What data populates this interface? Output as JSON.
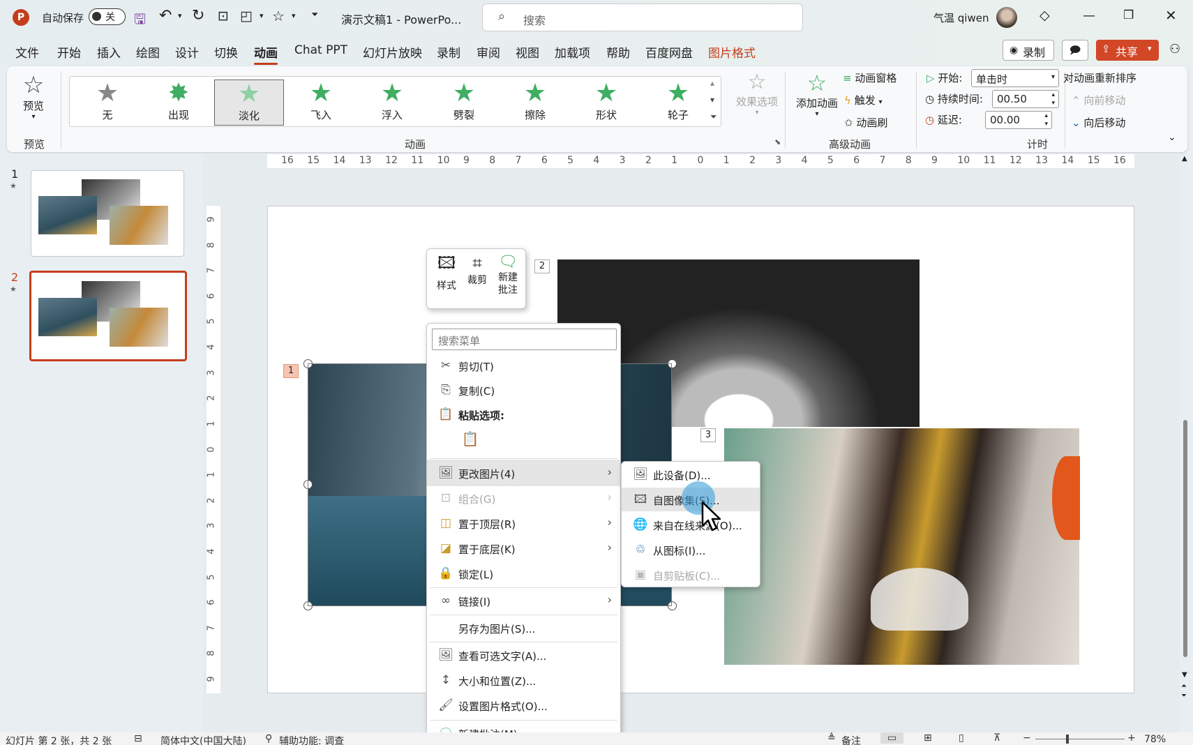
{
  "titlebar": {
    "autosave_label": "自动保存",
    "autosave_state": "关",
    "doc_title": "演示文稿1  -  PowerPo...",
    "search_placeholder": "搜索",
    "user_name": "气温 qiwen"
  },
  "tabs": [
    "文件",
    "开始",
    "插入",
    "绘图",
    "设计",
    "切换",
    "动画",
    "Chat PPT",
    "幻灯片放映",
    "录制",
    "审阅",
    "视图",
    "加载项",
    "帮助",
    "百度网盘",
    "图片格式"
  ],
  "actions": {
    "record": "录制",
    "share": "共享"
  },
  "ribbon": {
    "preview": {
      "button": "预览",
      "group": "预览"
    },
    "animation_group": "动画",
    "animations": [
      "无",
      "出现",
      "淡化",
      "飞入",
      "浮入",
      "劈裂",
      "擦除",
      "形状",
      "轮子"
    ],
    "effect_options": "效果选项",
    "advanced": {
      "add_animation": "添加动画",
      "pane": "动画窗格",
      "trigger": "触发",
      "painter": "动画刷",
      "group": "高级动画"
    },
    "timing": {
      "start_label": "开始:",
      "start_value": "单击时",
      "duration_label": "持续时间:",
      "duration_value": "00.50",
      "delay_label": "延迟:",
      "delay_value": "00.00",
      "group": "计时"
    },
    "reorder": {
      "title": "对动画重新排序",
      "forward": "向前移动",
      "backward": "向后移动"
    }
  },
  "ruler_h": [
    "16",
    "15",
    "14",
    "13",
    "12",
    "11",
    "10",
    "9",
    "8",
    "7",
    "6",
    "5",
    "4",
    "3",
    "2",
    "1",
    "0",
    "1",
    "2",
    "3",
    "4",
    "5",
    "6",
    "7",
    "8",
    "9",
    "10",
    "11",
    "12",
    "13",
    "14",
    "15",
    "16"
  ],
  "ruler_v": [
    "9",
    "8",
    "7",
    "6",
    "5",
    "4",
    "3",
    "2",
    "1",
    "0",
    "1",
    "2",
    "3",
    "4",
    "5",
    "6",
    "7",
    "8",
    "9"
  ],
  "slides": [
    {
      "number": "1"
    },
    {
      "number": "2"
    }
  ],
  "mini_toolbar": {
    "style": "样式",
    "crop": "裁剪",
    "comment_line1": "新建",
    "comment_line2": "批注"
  },
  "tags": {
    "t1": "1",
    "t2": "2",
    "t3": "3"
  },
  "context_menu": {
    "search_placeholder": "搜索菜单",
    "cut": "剪切(T)",
    "copy": "复制(C)",
    "paste_options": "粘贴选项:",
    "change_picture": "更改图片(4)",
    "group": "组合(G)",
    "bring_front": "置于顶层(R)",
    "send_back": "置于底层(K)",
    "lock": "锁定(L)",
    "link": "链接(I)",
    "save_as_picture": "另存为图片(S)...",
    "alt_text": "查看可选文字(A)...",
    "size_position": "大小和位置(Z)...",
    "format_picture": "设置图片格式(O)...",
    "new_comment": "新建批注(M)"
  },
  "submenu": {
    "this_device": "此设备(D)...",
    "image_set": "自图像集(S)...",
    "online": "来自在线来源(O)...",
    "from_icons": "从图标(I)...",
    "from_clipboard": "自剪贴板(C)..."
  },
  "statusbar": {
    "slide_info": "幻灯片 第 2 张，共 2 张",
    "language": "简体中文(中国大陆)",
    "accessibility": "辅助功能: 调查",
    "notes": "备注",
    "zoom": "78%"
  }
}
